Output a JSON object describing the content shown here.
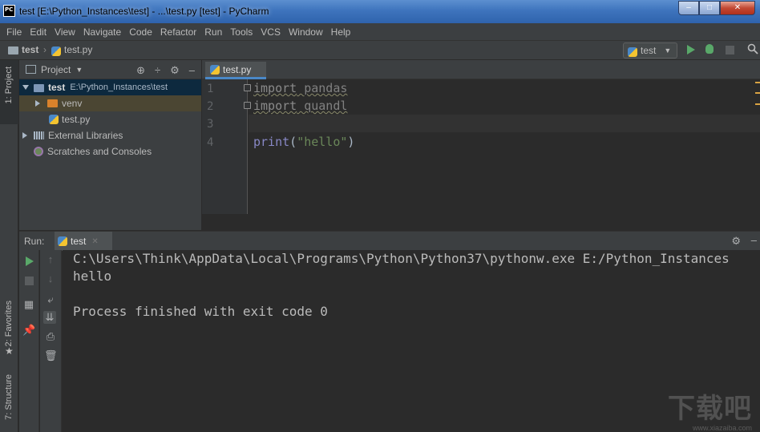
{
  "window": {
    "title": "test [E:\\Python_Instances\\test] - ...\\test.py [test] - PyCharm",
    "minimize": "–",
    "maximize": "□",
    "close": "✕"
  },
  "menu": [
    "File",
    "Edit",
    "View",
    "Navigate",
    "Code",
    "Refactor",
    "Run",
    "Tools",
    "VCS",
    "Window",
    "Help"
  ],
  "breadcrumb": {
    "project": "test",
    "file": "test.py"
  },
  "run_config": {
    "label": "test"
  },
  "left_strip": {
    "project_tab": "1: Project",
    "favorites_tab": "2: Favorites",
    "structure_tab": "7: Structure"
  },
  "project_panel": {
    "title": "Project",
    "tree": {
      "root_name": "test",
      "root_path": "E:\\Python_Instances\\test",
      "venv": "venv",
      "file": "test.py",
      "external": "External Libraries",
      "scratches": "Scratches and Consoles"
    }
  },
  "editor": {
    "tab_label": "test.py",
    "line_numbers": [
      "1",
      "2",
      "3",
      "4"
    ],
    "lines": {
      "l1_kw": "import",
      "l1_mod": " pandas",
      "l2_kw": "import",
      "l2_mod": " quandl",
      "l4_fn": "print",
      "l4_open": "(",
      "l4_str": "\"hello\"",
      "l4_close": ")"
    }
  },
  "run_panel": {
    "label": "Run:",
    "tab": "test",
    "console": [
      "C:\\Users\\Think\\AppData\\Local\\Programs\\Python\\Python37\\pythonw.exe E:/Python_Instances",
      "hello",
      "",
      "Process finished with exit code 0"
    ]
  },
  "watermark": {
    "text": "下载吧",
    "url": "www.xiazaiba.com"
  },
  "colors": {
    "keyword": "#cc7832",
    "string": "#6a8759",
    "builtin": "#8888c6",
    "background": "#2b2b2b",
    "panel": "#3c3f41"
  }
}
